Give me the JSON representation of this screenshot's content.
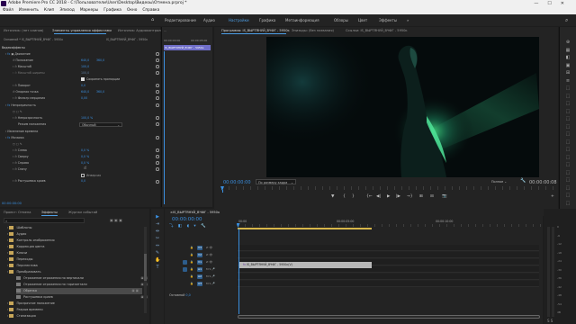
{
  "window": {
    "title": "Adobe Premiere Pro CC 2018 - C:\\Пользователи\\User\\Desktop\\Видеоы\\Отмена.prproj *",
    "controls": [
      "—",
      "☐",
      "✕"
    ]
  },
  "menu": [
    "Файл",
    "Изменить",
    "Клип",
    "Эпизод",
    "Маркеры",
    "Графика",
    "Окно",
    "Справка"
  ],
  "workspaces": {
    "items": [
      "Редактирование",
      "Аудио",
      "Настройки",
      "Графика",
      "Метаинформация",
      "Обзоры",
      "Цвет",
      "Эффекты"
    ],
    "active_index": 2
  },
  "effect_controls": {
    "tabs": [
      "Источник: (нет клипов)",
      "Элементы управления эффектами",
      "Микшер клипа",
      "Источник: Аудиоконтроль"
    ],
    "active_tab": 1,
    "clip_path": "Основной * IS_ВЫРТЯНУЙ_ВЧФГ - 5950к",
    "sequence_path": "…",
    "header_time": "00:00:00:00",
    "header_time2": "00:00:05:00",
    "clip_label": "IS_ВЫРТЯНУЙ_ВЧФГ - 5950к",
    "sections": {
      "video_effects": "Видеоэффекты",
      "motion": "Движение",
      "opacity": "Непрозрачность",
      "time_remap": "Изменение времени",
      "mosaic": "Мозаика"
    },
    "motion_rows": [
      {
        "label": "Положение",
        "value": "640,0",
        "value2": "360,0"
      },
      {
        "label": "Масштаб",
        "value": "100,0"
      },
      {
        "label": "Масштаб ширины",
        "value": "100,0"
      },
      {
        "label": "Сохранять пропорции",
        "value": ""
      },
      {
        "label": "Поворот",
        "value": "0,0"
      },
      {
        "label": "Опорная точка",
        "value": "640,0",
        "value2": "360,0"
      },
      {
        "label": "Фильтр мерцания",
        "value": "0,00"
      }
    ],
    "opacity_rows": [
      {
        "label": "Непрозрачность",
        "value": "100,0 %"
      },
      {
        "label": "Режим наложения",
        "value": "Обычный"
      }
    ],
    "mosaic_rows": [
      {
        "label": "Слева",
        "value": "0,0 %"
      },
      {
        "label": "Сверху",
        "value": "0,0 %"
      },
      {
        "label": "Справа",
        "value": "0,0 %"
      },
      {
        "label": "Снизу",
        "value": "0,0 %"
      },
      {
        "label": "Растушевка краев",
        "value": "0,0"
      }
    ],
    "mosaic_check_label": "Инверсия",
    "footer_time": "00:00:00:00"
  },
  "program": {
    "tabs": [
      "Программа: IS_ВЫРТЯНУЙ_ВЧФГ - 5950к",
      "Эпизоды: (без названия)",
      "Ссылки: IS_ВЫРТЯНУЙ_ВЧФГ - 5950к"
    ],
    "active_tab": 0,
    "timecode": "00:00:00:00",
    "fit": "По размеру кадра",
    "quality": "Полное",
    "duration": "00:00:00:08",
    "transport": [
      "▼",
      "{",
      "}",
      "{←",
      "◀|",
      "▶",
      "|▶",
      "→}",
      "⊞",
      "⊟",
      "📷",
      "+"
    ]
  },
  "project": {
    "tabs": [
      "Проект: Отмена",
      "Эффекты",
      "Журнал событий"
    ],
    "active_tab": 1,
    "tree": [
      {
        "label": "Шаблоны",
        "indent": 0
      },
      {
        "label": "Аудио",
        "indent": 0
      },
      {
        "label": "Контроль изображения",
        "indent": 0
      },
      {
        "label": "Коррекция цвета",
        "indent": 0
      },
      {
        "label": "Ключи",
        "indent": 0
      },
      {
        "label": "Переходы",
        "indent": 0
      },
      {
        "label": "Перспектива",
        "indent": 0
      },
      {
        "label": "Преобразовать",
        "indent": 0
      },
      {
        "label": "Отражение отражения по вертикали",
        "indent": 1
      },
      {
        "label": "Отражение отражения по горизонтали",
        "indent": 1
      },
      {
        "label": "Обрезка",
        "indent": 1,
        "selected": true
      },
      {
        "label": "Растушевка краев",
        "indent": 1
      },
      {
        "label": "Прозрачное наложение",
        "indent": 0
      },
      {
        "label": "Разрыв времени",
        "indent": 0
      },
      {
        "label": "Стилизация",
        "indent": 0
      }
    ]
  },
  "timeline": {
    "tab": "IS_ВЫРТЯНУЙ_ВЧФГ - 5950к",
    "timecode": "00:00:00:00",
    "ruler": [
      "00:00",
      "00:00:05:00",
      "00:00:10:00"
    ],
    "video_tracks": [
      "V3",
      "V2",
      "V1"
    ],
    "audio_tracks": [
      "A1",
      "A2",
      "A3"
    ],
    "master_label": "Основной",
    "master_value": "0,0",
    "clip_name": "IS_ВЫРТЯНУЙ_ВЧФГ - 5950к(V)"
  },
  "tools": [
    "▶",
    "⇥",
    "⇹",
    "✂",
    "⇔",
    "✎",
    "✋",
    "T"
  ],
  "meter_labels": [
    "0",
    "-6",
    "-12",
    "-18",
    "-24",
    "-30",
    "-36",
    "-42",
    "-48",
    "-54",
    "dB"
  ],
  "right_toolbar": [
    "⊕",
    "▦",
    "◧",
    "▣",
    "⊞",
    "≡",
    "⬚",
    "⬚",
    "⬚",
    "⬚",
    "⬚",
    "⬚",
    "⬚",
    "⬚",
    "⬚",
    "⬚",
    "⬚",
    "⬚",
    "⬚",
    "⬚",
    "⬚",
    "⬚"
  ],
  "colors": {
    "accent": "#3a8fe0",
    "clip_purple": "#6f6ec9",
    "clip_gray": "#b8b8b8",
    "workarea": "#d7b64a"
  }
}
